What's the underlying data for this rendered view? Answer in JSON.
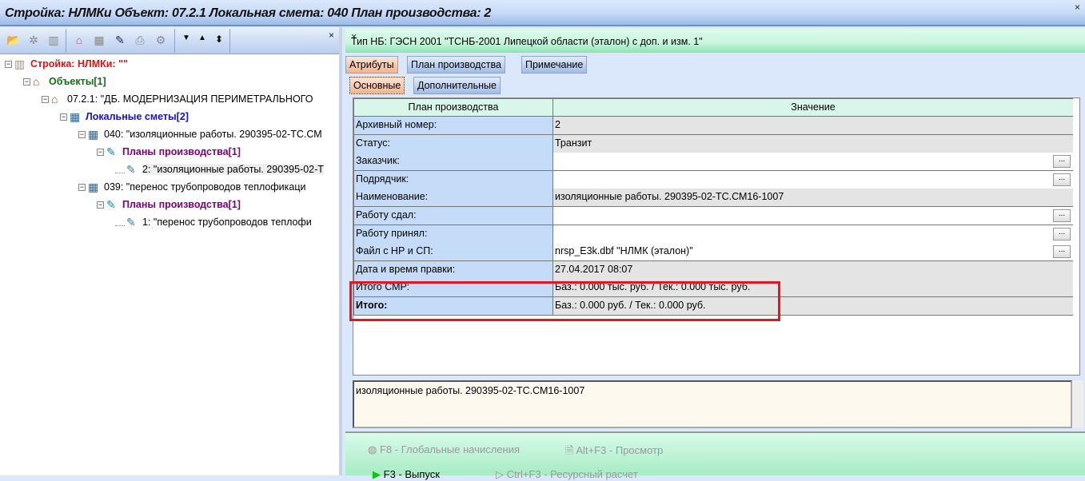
{
  "window": {
    "title": "Стройка: НЛМКи  Объект: 07.2.1  Локальная смета: 040  План производства: 2"
  },
  "tree": [
    {
      "label": "Стройка: НЛМКи: \"\"",
      "color": "#e81010",
      "bold": true,
      "icon": "building-icon"
    },
    {
      "label": "Объекты[1]",
      "color": "#107010",
      "bold": true,
      "icon": "house-icon"
    },
    {
      "label": "07.2.1: \"ДБ. МОДЕРНИЗАЦИЯ ПЕРИМЕТРАЛЬНОГО",
      "color": "#000",
      "bold": false,
      "icon": "house-icon"
    },
    {
      "label": "Локальные сметы[2]",
      "color": "#1010e8",
      "bold": true,
      "icon": "table-icon"
    },
    {
      "label": "040: \"изоляционные работы. 290395-02-ТС.СМ",
      "color": "#000",
      "bold": false,
      "icon": "table-icon"
    },
    {
      "label": "Планы производства[1]",
      "color": "#800080",
      "bold": true,
      "icon": "notepad-icon"
    },
    {
      "label": "2: \"изоляционные работы. 290395-02-Т",
      "color": "#000",
      "bold": false,
      "icon": "notepad-icon"
    },
    {
      "label": "039: \"перенос трубопроводов теплофикаци",
      "color": "#000",
      "bold": false,
      "icon": "table-icon"
    },
    {
      "label": "Планы производства[1]",
      "color": "#800080",
      "bold": true,
      "icon": "notepad-icon"
    },
    {
      "label": "1: \"перенос трубопроводов теплофи",
      "color": "#000",
      "bold": false,
      "icon": "notepad-icon"
    }
  ],
  "right": {
    "header": "Тип НБ: ГЭСН 2001 \"ТСНБ-2001 Липецкой области (эталон) с доп. и изм. 1\"",
    "tabs": [
      "Атрибуты",
      "План производства",
      "Примечание"
    ],
    "subtabs": [
      "Основные",
      "Дополнительные"
    ],
    "grid": {
      "headers": [
        "План производства",
        "Значение"
      ],
      "rows": [
        {
          "label": "Архивный номер:",
          "value": "2"
        },
        {
          "label": "Статус:",
          "value": "Транзит"
        },
        {
          "label": "Заказчик:",
          "value": ""
        },
        {
          "label": "Подрядчик:",
          "value": ""
        },
        {
          "label": "Наименование:",
          "value": "изоляционные работы. 290395-02-ТС.СМ16-1007"
        },
        {
          "label": "Работу сдал:",
          "value": ""
        },
        {
          "label": "Работу принял:",
          "value": ""
        },
        {
          "label": "Файл с НР и СП:",
          "value": "nrsp_E3k.dbf  \"НЛМК (эталон)\""
        },
        {
          "label": "Дата и время правки:",
          "value": "27.04.2017  08:07"
        },
        {
          "label": "Итого СМР:",
          "value": "Баз.: 0.000 тыс. руб. / Тек.: 0.000 тыс. руб."
        },
        {
          "label": "Итого:",
          "value": "Баз.: 0.000 руб. / Тек.: 0.000 руб."
        }
      ],
      "dots": "..."
    },
    "memo": "изоляционные работы. 290395-02-ТС.СМ16-1007",
    "buttons": [
      "F8 - Глобальные начисления",
      "Alt+F3 - Просмотр",
      "F3 - Выпуск",
      "Ctrl+F3 - Ресурсный расчет"
    ]
  }
}
